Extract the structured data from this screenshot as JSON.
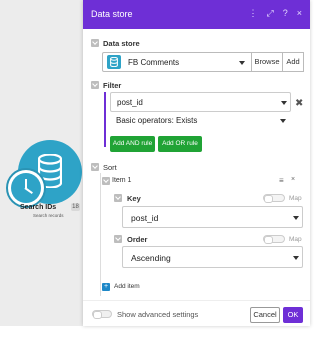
{
  "canvas": {
    "module": {
      "title": "Search IDs",
      "id_badge": "18",
      "subtitle": "Search records",
      "icon": "database-icon",
      "trigger_icon": "clock-icon",
      "color": "#2ea3c7"
    }
  },
  "panel": {
    "title": "Data store",
    "header_icons": [
      "more-vertical-icon",
      "expand-icon",
      "help-icon",
      "close-icon"
    ],
    "header_glyphs": {
      "more": "⋮",
      "expand": "⤢",
      "help": "?",
      "close": "×"
    },
    "accent": "#6e2fd6",
    "data_store": {
      "label": "Data store",
      "value": "FB Comments",
      "browse_label": "Browse",
      "add_label": "Add"
    },
    "filter": {
      "label": "Filter",
      "field_value": "post_id",
      "operator_value": "Basic operators: Exists",
      "add_and_label": "Add AND rule",
      "add_or_label": "Add OR rule",
      "remove_glyph": "✖",
      "button_color": "#20a335"
    },
    "sort": {
      "label": "Sort",
      "item_label": "Item 1",
      "item_menu_glyph": "≡",
      "item_close_glyph": "×",
      "key": {
        "label": "Key",
        "map_label": "Map",
        "value": "post_id"
      },
      "order": {
        "label": "Order",
        "map_label": "Map",
        "value": "Ascending"
      },
      "add_item_label": "Add item",
      "add_item_glyph": "+"
    },
    "footer": {
      "advanced_label": "Show advanced settings",
      "cancel_label": "Cancel",
      "ok_label": "OK"
    }
  }
}
